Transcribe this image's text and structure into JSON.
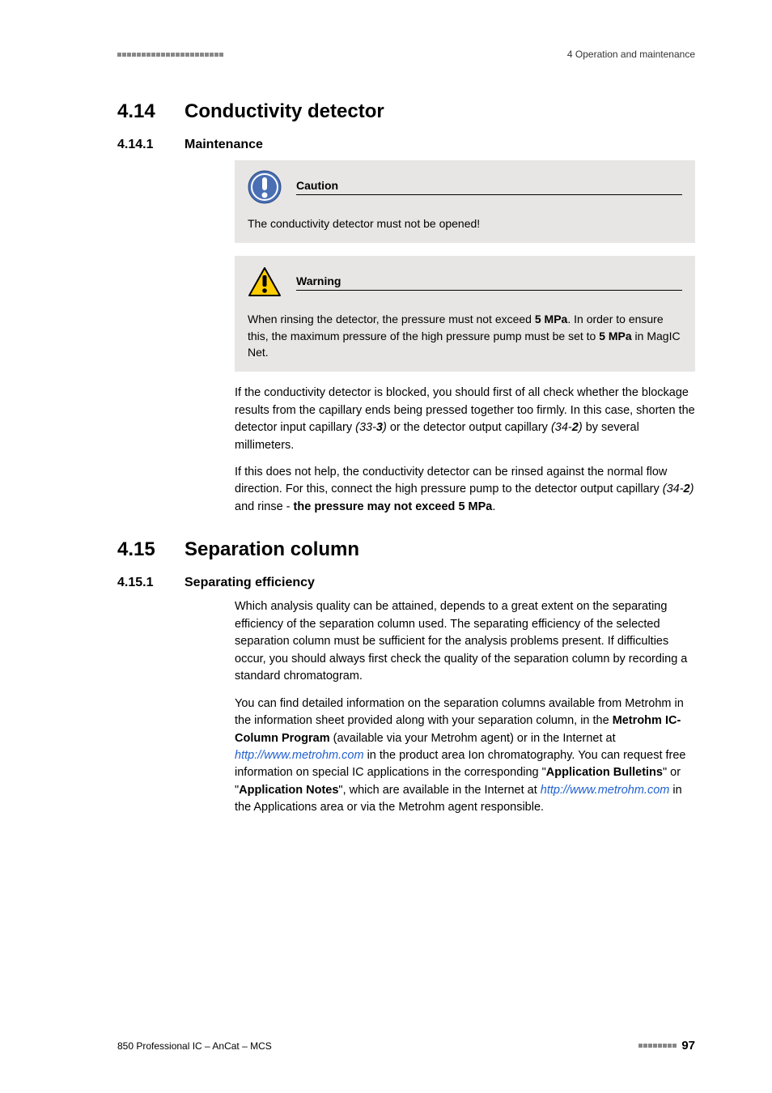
{
  "header": {
    "right": "4 Operation and maintenance"
  },
  "section_414": {
    "number": "4.14",
    "title": "Conductivity detector"
  },
  "subsection_4141": {
    "number": "4.14.1",
    "title": "Maintenance"
  },
  "caution": {
    "title": "Caution",
    "body": "The conductivity detector must not be opened!"
  },
  "warning": {
    "title": "Warning",
    "body_pre": "When rinsing the detector, the pressure must not exceed ",
    "body_mpa1": "5 MPa",
    "body_mid": ". In order to ensure this, the maximum pressure of the high pressure pump must be set to ",
    "body_mpa2": "5 MPa",
    "body_post": " in MagIC Net."
  },
  "para1": {
    "t1": "If the conductivity detector is blocked, you should first of all check whether the blockage results from the capillary ends being pressed together too firmly. In this case, shorten the detector input capillary ",
    "i1a": "(33-",
    "i1b": "3",
    "i1c": ")",
    "t2": " or the detector output capillary ",
    "i2a": "(34-",
    "i2b": "2",
    "i2c": ")",
    "t3": " by several millimeters."
  },
  "para2": {
    "t1": "If this does not help, the conductivity detector can be rinsed against the normal flow direction. For this, connect the high pressure pump to the detector output capillary ",
    "i1a": "(34-",
    "i1b": "2",
    "i1c": ")",
    "t2": " and rinse - ",
    "b1": "the pressure may not exceed 5 MPa",
    "t3": "."
  },
  "section_415": {
    "number": "4.15",
    "title": "Separation column"
  },
  "subsection_4151": {
    "number": "4.15.1",
    "title": "Separating efficiency"
  },
  "para3": "Which analysis quality can be attained, depends to a great extent on the separating efficiency of the separation column used. The separating efficiency of the selected separation column must be sufficient for the analysis problems present. If difficulties occur, you should always first check the quality of the separation column by recording a standard chromatogram.",
  "para4": {
    "t1": "You can find detailed information on the separation columns available from Metrohm in the information sheet provided along with your separation column, in the ",
    "b1": "Metrohm IC-Column Program",
    "t2": " (available via your Metrohm agent) or in the Internet at ",
    "link1": "http://www.metrohm.com",
    "t3": " in the product area Ion chromatography. You can request free information on special IC applications in the corresponding \"",
    "b2": "Application Bulletins",
    "t4": "\" or \"",
    "b3": "Application Notes",
    "t5": "\", which are available in the Internet at ",
    "link2": "http://www.metrohm.com",
    "t6": " in the Applications area or via the Metrohm agent responsible."
  },
  "footer": {
    "left": "850 Professional IC – AnCat – MCS",
    "page": "97"
  }
}
